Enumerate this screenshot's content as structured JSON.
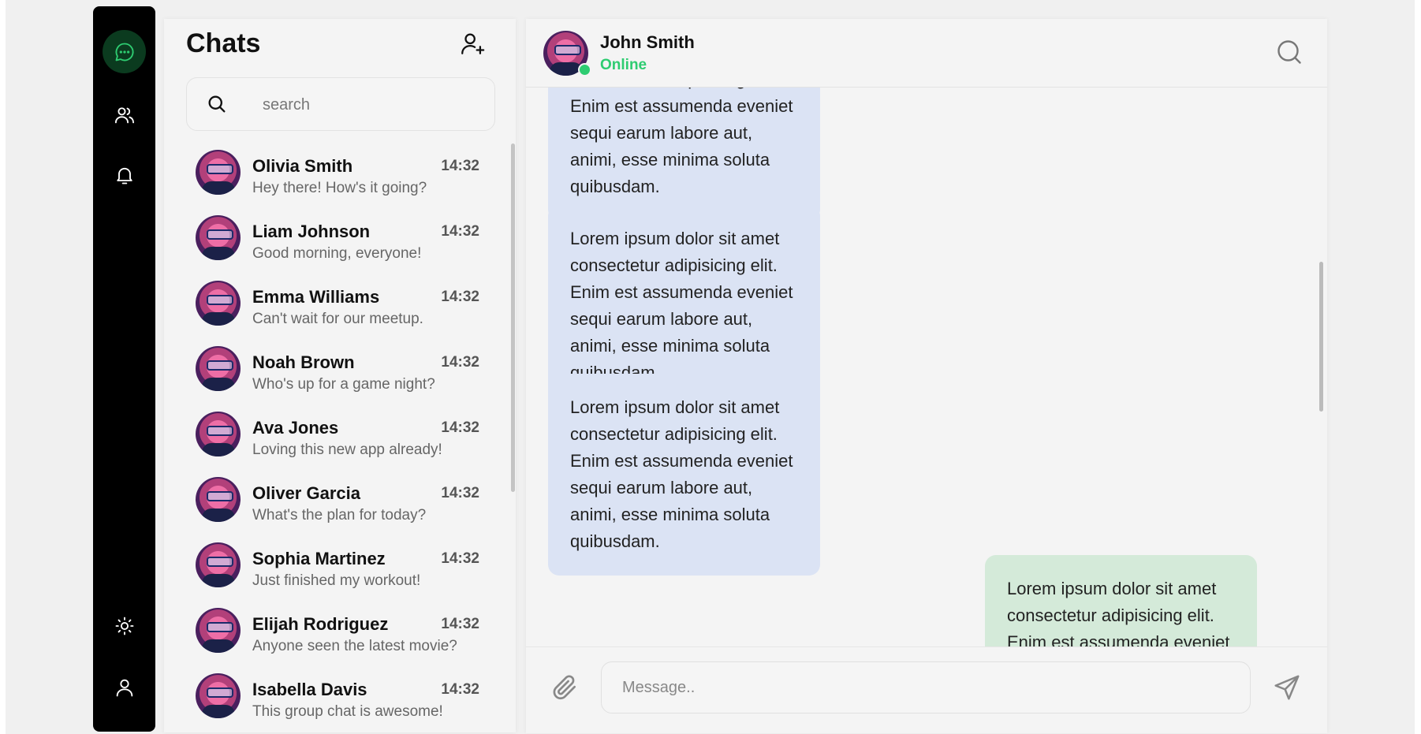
{
  "nav": {
    "items": [
      {
        "icon": "chat-icon",
        "active": true
      },
      {
        "icon": "users-icon",
        "active": false
      },
      {
        "icon": "bell-icon",
        "active": false
      },
      {
        "icon": "sun-icon",
        "active": false
      },
      {
        "icon": "user-icon",
        "active": false
      }
    ],
    "accent_color": "#2ecc71"
  },
  "chat_list": {
    "title": "Chats",
    "add_icon": "add-user-icon",
    "search_placeholder": "search",
    "items": [
      {
        "name": "Olivia Smith",
        "time": "14:32",
        "message": "Hey there! How's it going?"
      },
      {
        "name": "Liam Johnson",
        "time": "14:32",
        "message": "Good morning, everyone!"
      },
      {
        "name": "Emma Williams",
        "time": "14:32",
        "message": "Can't wait for our meetup."
      },
      {
        "name": "Noah Brown",
        "time": "14:32",
        "message": "Who's up for a game night?"
      },
      {
        "name": "Ava Jones",
        "time": "14:32",
        "message": "Loving this new app already!"
      },
      {
        "name": "Oliver Garcia",
        "time": "14:32",
        "message": "What's the plan for today?"
      },
      {
        "name": "Sophia Martinez",
        "time": "14:32",
        "message": "Just finished my workout!"
      },
      {
        "name": "Elijah Rodriguez",
        "time": "14:32",
        "message": "Anyone seen the latest movie?"
      },
      {
        "name": "Isabella Davis",
        "time": "14:32",
        "message": "This group chat is awesome!"
      }
    ]
  },
  "conversation": {
    "contact_name": "John Smith",
    "status": "Online",
    "messages": [
      {
        "direction": "in",
        "text": "Lorem ipsum dolor sit amet consectetur adipisicing elit. Enim est assumenda eveniet sequi earum labore aut, animi, esse minima soluta quibusdam."
      },
      {
        "direction": "in",
        "text": "Lorem ipsum dolor sit amet consectetur adipisicing elit. Enim est assumenda eveniet sequi earum labore aut, animi, esse minima soluta quibusdam."
      },
      {
        "direction": "in",
        "text": "Lorem ipsum dolor sit amet consectetur adipisicing elit. Enim est assumenda eveniet sequi earum labore aut, animi, esse minima soluta quibusdam."
      },
      {
        "direction": "out",
        "text": "Lorem ipsum dolor sit amet consectetur adipisicing elit. Enim est assumenda eveniet sequi earum labore aut, animi, esse minima soluta quibusdam."
      }
    ],
    "composer_placeholder": "Message.."
  }
}
